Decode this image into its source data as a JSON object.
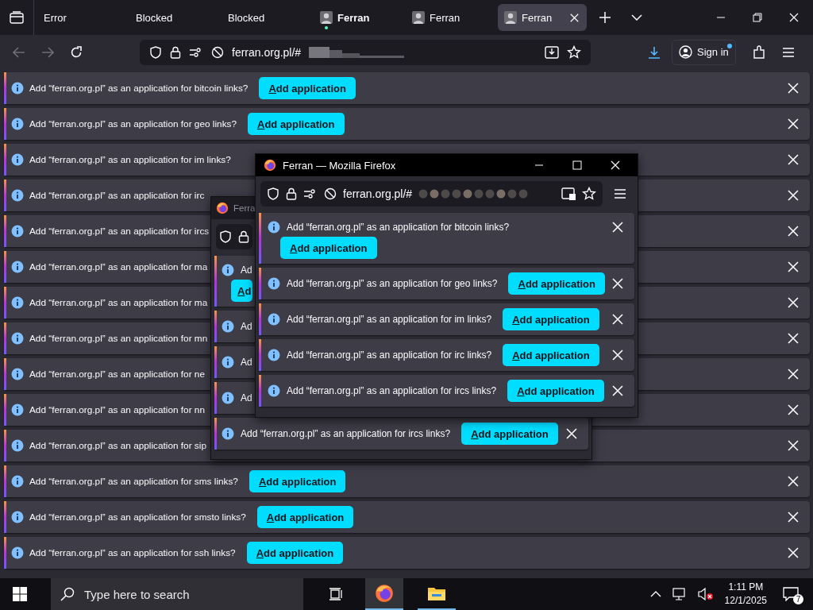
{
  "tabs": [
    {
      "label": "Error",
      "favicon": false,
      "attention": false,
      "selected": false
    },
    {
      "label": "Blocked",
      "favicon": false,
      "attention": false,
      "selected": false
    },
    {
      "label": "Blocked",
      "favicon": false,
      "attention": false,
      "selected": false
    },
    {
      "label": "Ferran",
      "favicon": true,
      "attention": true,
      "selected": false
    },
    {
      "label": "Ferran",
      "favicon": true,
      "attention": false,
      "selected": false
    },
    {
      "label": "Ferran",
      "favicon": true,
      "attention": false,
      "selected": true
    }
  ],
  "url": "ferran.org.pl/#",
  "sign_in": "Sign in",
  "bars": [
    {
      "text": "Add “ferran.org.pl” as an application for bitcoin links?",
      "button": "Add application"
    },
    {
      "text": "Add “ferran.org.pl” as an application for geo links?",
      "button": "Add application"
    },
    {
      "text": "Add “ferran.org.pl” as an application for im links?"
    },
    {
      "text": "Add “ferran.org.pl” as an application for irc"
    },
    {
      "text": "Add “ferran.org.pl” as an application for ircs"
    },
    {
      "text": "Add “ferran.org.pl” as an application for ma"
    },
    {
      "text": "Add “ferran.org.pl” as an application for ma"
    },
    {
      "text": "Add “ferran.org.pl” as an application for mn"
    },
    {
      "text": "Add “ferran.org.pl” as an application for ne"
    },
    {
      "text": "Add “ferran.org.pl” as an application for nn"
    },
    {
      "text": "Add “ferran.org.pl” as an application for sip"
    },
    {
      "text": "Add “ferran.org.pl” as an application for sms links?",
      "button": "Add application"
    },
    {
      "text": "Add “ferran.org.pl” as an application for smsto links?",
      "button": "Add application"
    },
    {
      "text": "Add “ferran.org.pl” as an application for ssh links?",
      "button": "Add application"
    }
  ],
  "windows": [
    {
      "title": "Ferra",
      "active": false,
      "bars": [
        {
          "text": "Ad",
          "button": "Ad",
          "kind": "stacked"
        },
        {
          "text": "Ad",
          "kind": "inline"
        },
        {
          "text": "Ad",
          "kind": "inline"
        },
        {
          "text": "Ad",
          "kind": "inline"
        },
        {
          "text": "Add “ferran.org.pl” as an application for ircs links?",
          "button": "Add application",
          "kind": "inline",
          "close": true
        }
      ]
    },
    {
      "title": "Ferran — Mozilla Firefox",
      "active": true,
      "url": "ferran.org.pl/#",
      "bars": [
        {
          "text": "Add “ferran.org.pl” as an application for bitcoin links?",
          "button": "Add application",
          "kind": "stacked",
          "close": true
        },
        {
          "text": "Add “ferran.org.pl” as an application for geo links?",
          "button": "Add application",
          "kind": "inline",
          "close": true
        },
        {
          "text": "Add “ferran.org.pl” as an application for im links?",
          "button": "Add application",
          "kind": "inline",
          "close": true
        },
        {
          "text": "Add “ferran.org.pl” as an application for irc links?",
          "button": "Add application",
          "kind": "inline",
          "close": true
        },
        {
          "text": "Add “ferran.org.pl” as an application for ircs links?",
          "button": "Add application",
          "kind": "inline",
          "close": true
        }
      ]
    }
  ],
  "taskbar": {
    "search_placeholder": "Type here to search",
    "time": "1:11 PM",
    "date": "12/1/2025",
    "notifications": "7"
  }
}
